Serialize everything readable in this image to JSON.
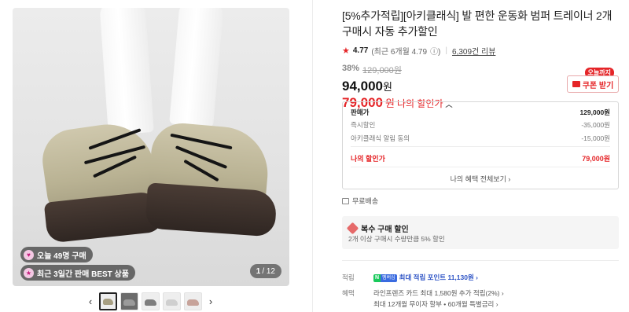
{
  "gallery": {
    "badges": [
      {
        "text": "오늘 49명 구매",
        "icon": "heart-icon"
      },
      {
        "text": "최근 3일간 판매 BEST 상품",
        "icon": "trophy-icon"
      }
    ],
    "pager": {
      "current": "1",
      "total": "/ 12"
    },
    "prev_arrow": "‹",
    "next_arrow": "›"
  },
  "product": {
    "title": "[5%추가적립][아키클래식] 발 편한 운동화 범퍼 트레이너 2개 구매시 자동 추가할인",
    "rating": "4.77",
    "rating_detail": "(최근 6개월 4.79",
    "rating_info": "ⓘ)",
    "reviews": "6,309건 리뷰",
    "discount_rate": "38%",
    "original_price": "129,000원",
    "price": "94,000",
    "price_unit": "원",
    "my_price": "79,000",
    "my_price_unit": "원",
    "my_price_label": "나의 할인가",
    "coupon_tag": "오늘까지",
    "coupon_label": "쿠폰 받기"
  },
  "breakdown": {
    "rows": [
      {
        "label": "판매가",
        "value": "129,000원"
      },
      {
        "label": "즉시할인",
        "value": "-35,000원"
      },
      {
        "label": "아키클래식 알림 동의",
        "value": "-15,000원"
      }
    ],
    "mine": {
      "label": "나의 할인가",
      "value": "79,000원"
    },
    "view_all": "나의 혜택 전체보기 ›"
  },
  "shipping": "무료배송",
  "multibuy": {
    "title": "복수 구매 할인",
    "desc": "2개 이상 구매시 수량만큼 5% 할인"
  },
  "benefits": {
    "points_key": "적립",
    "npay_n": "N",
    "npay_m": "멤버십",
    "points_value": "최대 적립 포인트 11,130원 ›",
    "card_key": "혜택",
    "card_line1": "라인프렌즈 카드 최대 1,580원 추가 적립(2%) ›",
    "card_line2": "최대 12개월 무이자 할부 • 60개월 특별금리 ›"
  },
  "colors": {
    "accent_red": "#e52528",
    "link_blue": "#2f55c6",
    "npay_green": "#19c95b"
  }
}
